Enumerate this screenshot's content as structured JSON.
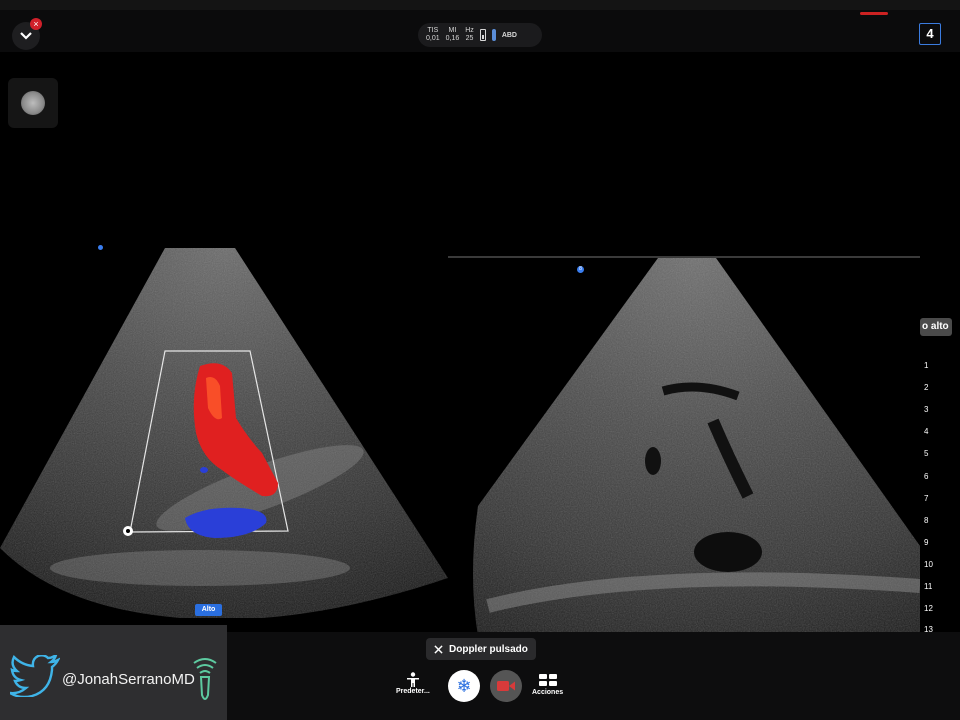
{
  "header": {
    "notification_badge": "×",
    "status": {
      "tis_label": "TIS",
      "tis_value": "0,01",
      "mi_label": "MI",
      "mi_value": "0,16",
      "hz_label": "Hz",
      "hz_value": "25",
      "preset": "ABD"
    },
    "page_count": "4"
  },
  "image": {
    "gain_label": "o alto",
    "depth_scale": [
      "1",
      "2",
      "3",
      "4",
      "5",
      "6",
      "7",
      "8",
      "9",
      "10",
      "11",
      "12",
      "13"
    ],
    "marker_right": "8",
    "alto_badge": "Alto"
  },
  "bottom": {
    "mode_label": "Doppler pulsado",
    "tools": {
      "presets_label": "Predeter...",
      "actions_label": "Acciones"
    }
  },
  "watermark": {
    "handle": "@JonahSerranoMD"
  },
  "colors": {
    "accent": "#2a6fe0",
    "doppler_red": "#e02020",
    "doppler_blue": "#2a3fd8",
    "notification": "#d0202a"
  }
}
